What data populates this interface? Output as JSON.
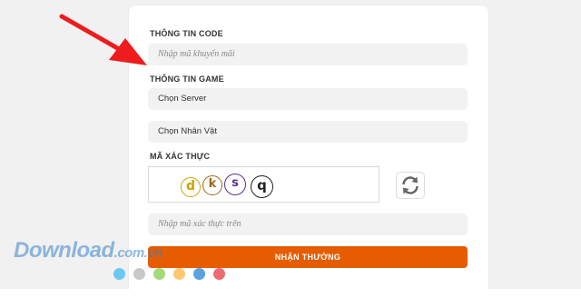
{
  "form": {
    "code_section_label": "THÔNG TIN CODE",
    "promo_input_placeholder": "Nhập mã khuyến mãi",
    "game_section_label": "THÔNG TIN GAME",
    "server_select_value": "Chọn Server",
    "character_select_value": "Chọn Nhân Vật",
    "verify_section_label": "MÃ XÁC THỰC",
    "captcha_chars": [
      "d",
      "k",
      "s",
      "q"
    ],
    "captcha_input_placeholder": "Nhập mã xác thực trên",
    "submit_label": "NHẬN THƯỞNG"
  },
  "watermark": {
    "brand": "Download",
    "ext": ".com.vn"
  },
  "icons": {
    "refresh": "refresh-icon",
    "arrow": "red-arrow-icon"
  },
  "colors": {
    "accent": "#e65c00",
    "arrow": "#ee1c1c",
    "watermark": "#3782c8",
    "captcha": [
      "#c9a400",
      "#9a6a1a",
      "#5a2f86",
      "#222222"
    ],
    "dots": [
      "#6cc8f0",
      "#c8c8c8",
      "#a6d97a",
      "#ffc870",
      "#5aa2e0",
      "#f06a72"
    ]
  }
}
